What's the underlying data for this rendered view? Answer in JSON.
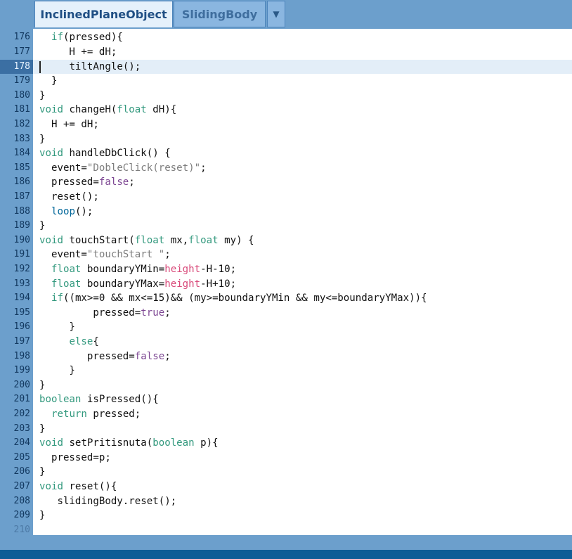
{
  "tabs": [
    {
      "label": "InclinedPlaneObject",
      "active": true
    },
    {
      "label": "SlidingBody",
      "active": false
    }
  ],
  "tab_menu_icon": "▼",
  "current_line": 178,
  "lines": [
    {
      "n": "176",
      "t": [
        [
          "  ",
          ""
        ],
        [
          "if",
          "kw"
        ],
        [
          "(pressed){",
          ""
        ]
      ]
    },
    {
      "n": "177",
      "t": [
        [
          "     H += dH;",
          ""
        ]
      ]
    },
    {
      "n": "178",
      "t": [
        [
          "     ",
          ""
        ],
        [
          "tiltAngle",
          ""
        ],
        [
          "();",
          ""
        ]
      ]
    },
    {
      "n": "179",
      "t": [
        [
          "  }",
          ""
        ]
      ]
    },
    {
      "n": "180",
      "t": [
        [
          "}",
          ""
        ]
      ]
    },
    {
      "n": "181",
      "t": [
        [
          "void",
          "kw"
        ],
        [
          " changeH(",
          ""
        ],
        [
          "float",
          "kw"
        ],
        [
          " dH){",
          ""
        ]
      ]
    },
    {
      "n": "182",
      "t": [
        [
          "  H += dH;",
          ""
        ]
      ]
    },
    {
      "n": "183",
      "t": [
        [
          "}",
          ""
        ]
      ]
    },
    {
      "n": "184",
      "t": [
        [
          "void",
          "kw"
        ],
        [
          " handleDbClick() {",
          ""
        ]
      ]
    },
    {
      "n": "185",
      "t": [
        [
          "  event=",
          ""
        ],
        [
          "\"DobleClick(reset)\"",
          "str"
        ],
        [
          ";",
          ""
        ]
      ]
    },
    {
      "n": "186",
      "t": [
        [
          "  pressed=",
          ""
        ],
        [
          "false",
          "lit"
        ],
        [
          ";",
          ""
        ]
      ]
    },
    {
      "n": "187",
      "t": [
        [
          "  reset();",
          ""
        ]
      ]
    },
    {
      "n": "188",
      "t": [
        [
          "  ",
          ""
        ],
        [
          "loop",
          "fn"
        ],
        [
          "();",
          ""
        ]
      ]
    },
    {
      "n": "189",
      "t": [
        [
          "}",
          ""
        ]
      ]
    },
    {
      "n": "190",
      "t": [
        [
          "void",
          "kw"
        ],
        [
          " touchStart(",
          ""
        ],
        [
          "float",
          "kw"
        ],
        [
          " mx,",
          ""
        ],
        [
          "float",
          "kw"
        ],
        [
          " my) {",
          ""
        ]
      ]
    },
    {
      "n": "191",
      "t": [
        [
          "  event=",
          ""
        ],
        [
          "\"touchStart \"",
          "str"
        ],
        [
          ";",
          ""
        ]
      ]
    },
    {
      "n": "192",
      "t": [
        [
          "  ",
          ""
        ],
        [
          "float",
          "kw"
        ],
        [
          " boundaryYMin=",
          ""
        ],
        [
          "height",
          "sym"
        ],
        [
          "-H-10;",
          ""
        ]
      ]
    },
    {
      "n": "193",
      "t": [
        [
          "  ",
          ""
        ],
        [
          "float",
          "kw"
        ],
        [
          " boundaryYMax=",
          ""
        ],
        [
          "height",
          "sym"
        ],
        [
          "-H+10;",
          ""
        ]
      ]
    },
    {
      "n": "194",
      "t": [
        [
          "  ",
          ""
        ],
        [
          "if",
          "kw"
        ],
        [
          "((mx>=0 && mx<=15)&& (my>=boundaryYMin && my<=boundaryYMax)){",
          ""
        ]
      ]
    },
    {
      "n": "195",
      "t": [
        [
          "         pressed=",
          ""
        ],
        [
          "true",
          "lit"
        ],
        [
          ";",
          ""
        ]
      ]
    },
    {
      "n": "196",
      "t": [
        [
          "     }",
          ""
        ]
      ]
    },
    {
      "n": "197",
      "t": [
        [
          "     ",
          ""
        ],
        [
          "else",
          "kw"
        ],
        [
          "{",
          ""
        ]
      ]
    },
    {
      "n": "198",
      "t": [
        [
          "        pressed=",
          ""
        ],
        [
          "false",
          "lit"
        ],
        [
          ";",
          ""
        ]
      ]
    },
    {
      "n": "199",
      "t": [
        [
          "     }",
          ""
        ]
      ]
    },
    {
      "n": "200",
      "t": [
        [
          "}",
          ""
        ]
      ]
    },
    {
      "n": "201",
      "t": [
        [
          "boolean",
          "kw"
        ],
        [
          " isPressed(){",
          ""
        ]
      ]
    },
    {
      "n": "202",
      "t": [
        [
          "  ",
          ""
        ],
        [
          "return",
          "kw"
        ],
        [
          " pressed;",
          ""
        ]
      ]
    },
    {
      "n": "203",
      "t": [
        [
          "}",
          ""
        ]
      ]
    },
    {
      "n": "204",
      "t": [
        [
          "void",
          "kw"
        ],
        [
          " setPritisnuta(",
          ""
        ],
        [
          "boolean",
          "kw"
        ],
        [
          " p){",
          ""
        ]
      ]
    },
    {
      "n": "205",
      "t": [
        [
          "  pressed=p;",
          ""
        ]
      ]
    },
    {
      "n": "206",
      "t": [
        [
          "}",
          ""
        ]
      ]
    },
    {
      "n": "207",
      "t": [
        [
          "void",
          "kw"
        ],
        [
          " reset(){",
          ""
        ]
      ]
    },
    {
      "n": "208",
      "t": [
        [
          "   slidingBody.reset();",
          ""
        ]
      ]
    },
    {
      "n": "209",
      "t": [
        [
          "}",
          ""
        ]
      ]
    },
    {
      "n": "210",
      "t": []
    }
  ]
}
